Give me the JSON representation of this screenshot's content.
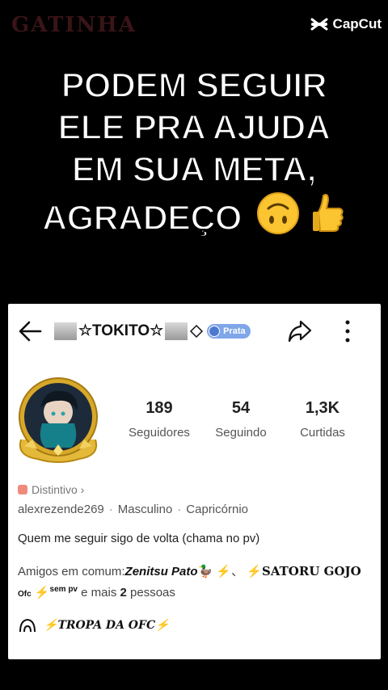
{
  "watermark": "GATINHA",
  "capcut": {
    "label": "CapCut"
  },
  "caption": {
    "lines": [
      "PODEM SEGUIR",
      "ELE PRA AJUDA",
      "EM SUA META,",
      "AGRADEÇO"
    ]
  },
  "profile": {
    "name": "☆TOKITO☆",
    "badge": "Prata",
    "stats": [
      {
        "value": "189",
        "label": "Seguidores"
      },
      {
        "value": "54",
        "label": "Seguindo"
      },
      {
        "value": "1,3K",
        "label": "Curtidas"
      }
    ],
    "distintivo": "Distintivo ›",
    "meta": [
      "alexrezende269",
      "Masculino",
      "Capricórnio"
    ],
    "bio": "Quem me seguir sigo de volta (chama no  pv)",
    "friends": {
      "prefix": "Amigos em comum:",
      "friend1": "Zenitsu Pato",
      "separator": "、",
      "friend2": "SATORU GOJO",
      "friend2b": "Ofc",
      "friend2c": "sem pv",
      "suffix": " e mais ",
      "count": "2",
      "suffix2": " pessoas"
    },
    "group": "TROPA DA OFC"
  },
  "colors": {
    "background": "#000000",
    "card": "#ffffff",
    "badge": "#7fa6e8",
    "bolt": "#f5c518"
  }
}
